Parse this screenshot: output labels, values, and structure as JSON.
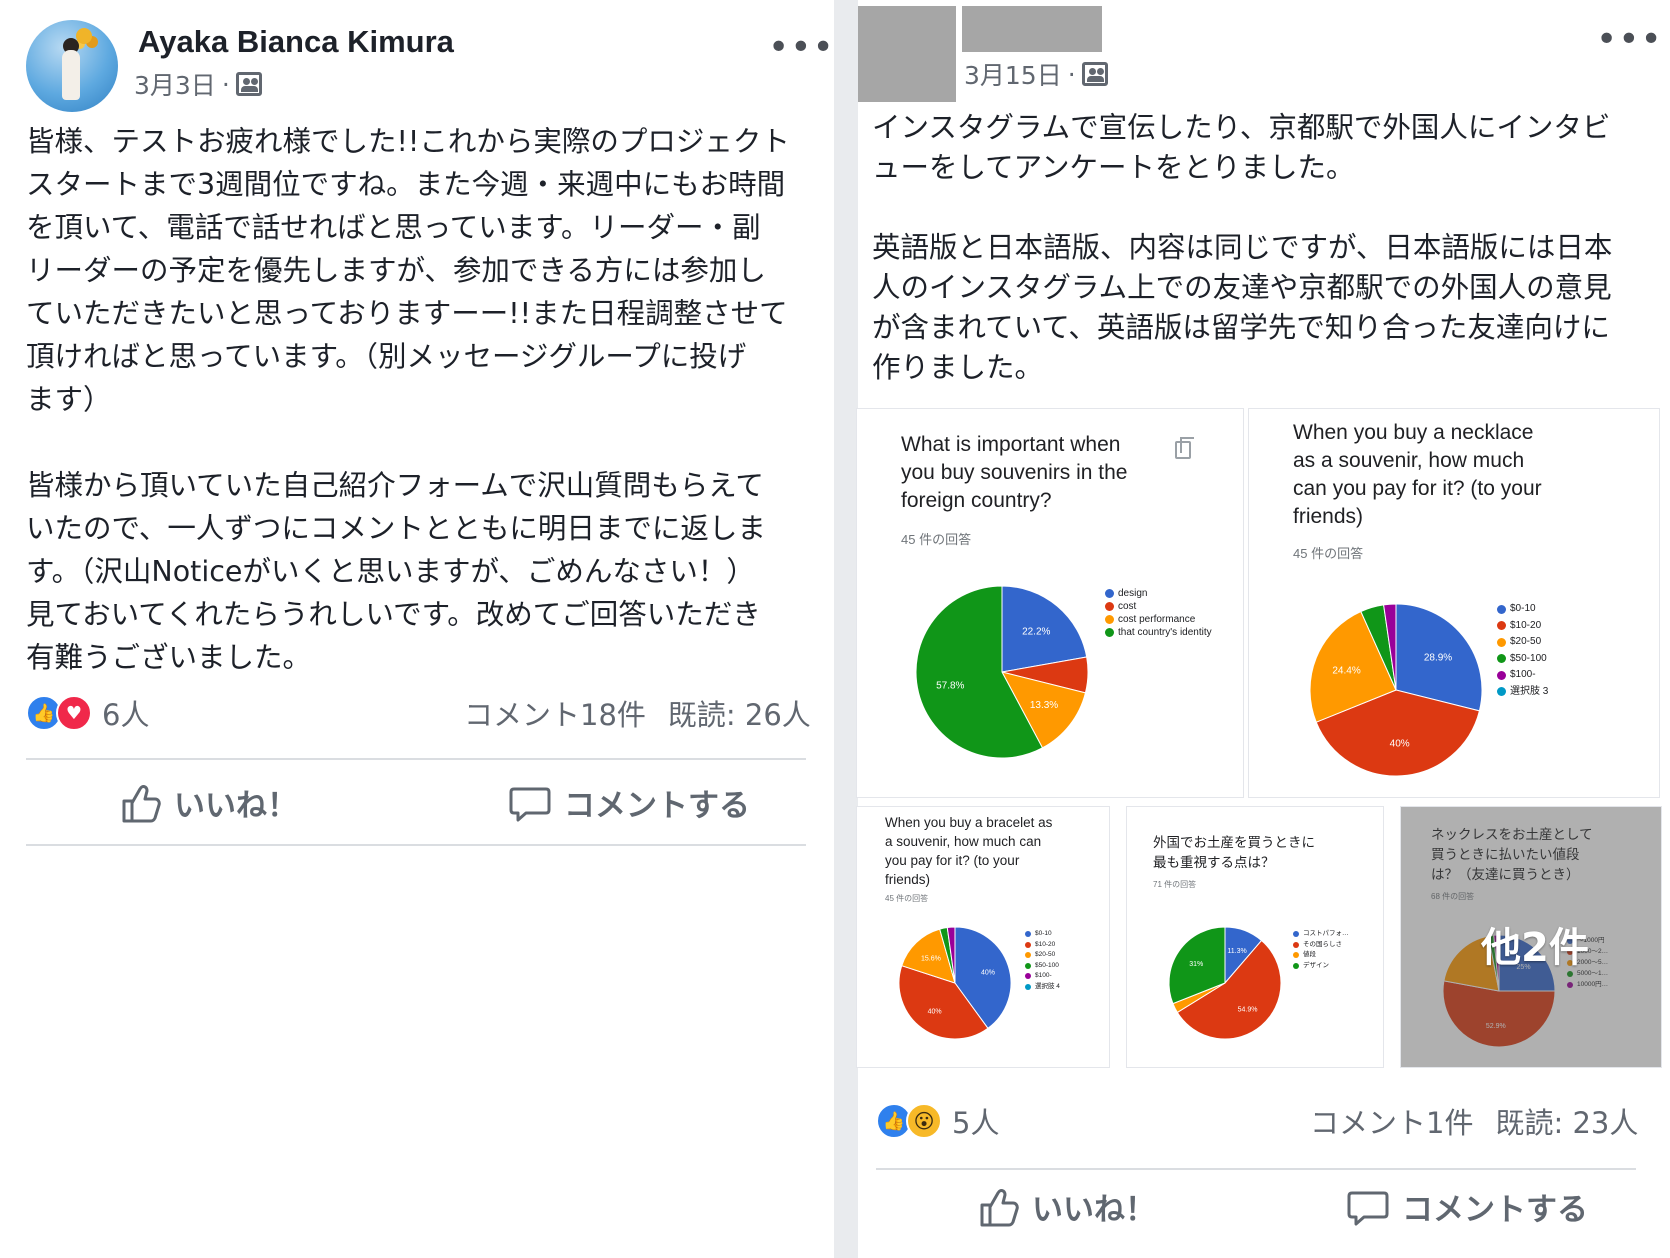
{
  "colors": {
    "blue": "#3366cc",
    "red": "#dc3912",
    "orange": "#ff9900",
    "green": "#109618",
    "purple": "#990099",
    "teal": "#0099c6"
  },
  "post1": {
    "author": "Ayaka Bianca Kimura",
    "date": "3月3日",
    "audience_icon": "group-audience-icon",
    "more": "•••",
    "body": "皆様、テストお疲れ様でした!!これから実際のプロジェクト\nスタートまで3週間位ですね。また今週・来週中にもお時間\nを頂いて、電話で話せればと思っています。リーダー・副\nリーダーの予定を優先しますが、参加できる方には参加し\nていただきたいと思っておりますーー!!また日程調整させて\n頂ければと思っています。（別メッセージグループに投げ\nます）\n\n皆様から頂いていた自己紹介フォームで沢山質問もらえて\nいたので、一人ずつにコメントとともに明日までに返しま\nす。（沢山Noticeがいくと思いますが、ごめんなさい！）\n見ておいてくれたらうれしいです。改めてご回答いただき\n有難うございました。",
    "reaction_count": "6人",
    "comments": "コメント18件",
    "seen": "既読: 26人",
    "like_label": "いいね！",
    "comment_label": "コメントする"
  },
  "post2": {
    "date": "3月15日",
    "more": "•••",
    "body": "インスタグラムで宣伝したり、京都駅で外国人にインタビ\nューをしてアンケートをとりました。\n\n英語版と日本語版、内容は同じですが、日本語版には日本\n人のインスタグラム上での友達や京都駅での外国人の意見\nが含まれていて、英語版は留学先で知り合った友達向けに\n作りました。",
    "reaction_count": "5人",
    "comments": "コメント1件",
    "seen": "既読: 23人",
    "like_label": "いいね！",
    "comment_label": "コメントする",
    "more_photos": "他2件"
  },
  "charts_text": {
    "c1": {
      "title": "What is important when\nyou buy souvenirs in the\nforeign country?",
      "responses": "45 件の回答"
    },
    "c2": {
      "title": "When you buy a necklace\nas a souvenir, how much\ncan you pay for it? (to your\nfriends)",
      "responses": "45 件の回答"
    },
    "c3": {
      "title": "When you buy a bracelet as\na souvenir, how much can\nyou pay for it? (to your\nfriends)",
      "responses": "45 件の回答"
    },
    "c4": {
      "title": "外国でお土産を買うときに\n最も重視する点は？",
      "responses": "71 件の回答"
    },
    "c5": {
      "title": "ネックレスをお土産として\n買うときに払いたい値段\nは？（友達に買うとき）",
      "responses": "68 件の回答"
    }
  },
  "chart_data": [
    {
      "type": "pie",
      "title": "What is important when you buy souvenirs in the foreign country?",
      "categories": [
        "design",
        "cost",
        "cost performance",
        "that country's identity"
      ],
      "values": [
        22.2,
        6.7,
        13.3,
        57.8
      ],
      "labels": [
        "22.2%",
        "",
        "13.3%",
        "57.8%"
      ],
      "colors": [
        "#3366cc",
        "#dc3912",
        "#ff9900",
        "#109618"
      ],
      "legend": "right"
    },
    {
      "type": "pie",
      "title": "When you buy a necklace as a souvenir, how much can you pay for it? (to your friends)",
      "categories": [
        "$0-10",
        "$10-20",
        "$20-50",
        "$50-100",
        "$100-",
        "選択肢 3"
      ],
      "values": [
        28.9,
        40,
        24.4,
        4.4,
        2.3,
        0
      ],
      "labels": [
        "28.9%",
        "40%",
        "24.4%",
        "",
        "",
        ""
      ],
      "colors": [
        "#3366cc",
        "#dc3912",
        "#ff9900",
        "#109618",
        "#990099",
        "#0099c6"
      ],
      "legend": "right"
    },
    {
      "type": "pie",
      "title": "When you buy a bracelet as a souvenir, how much can you pay for it? (to your friends)",
      "categories": [
        "$0-10",
        "$10-20",
        "$20-50",
        "$50-100",
        "$100-",
        "選択肢 4"
      ],
      "values": [
        40,
        40,
        15.6,
        2.2,
        2.2,
        0
      ],
      "labels": [
        "40%",
        "40%",
        "15.6%",
        "",
        "",
        ""
      ],
      "colors": [
        "#3366cc",
        "#dc3912",
        "#ff9900",
        "#109618",
        "#990099",
        "#0099c6"
      ],
      "legend": "right"
    },
    {
      "type": "pie",
      "title": "外国でお土産を買うときに最も重視する点は？",
      "categories": [
        "コストパフォ…",
        "その国らしさ",
        "値段",
        "デザイン"
      ],
      "values": [
        11.3,
        54.9,
        2.8,
        31
      ],
      "labels": [
        "11.3%",
        "54.9%",
        "",
        "31%"
      ],
      "colors": [
        "#3366cc",
        "#dc3912",
        "#ff9900",
        "#109618"
      ],
      "legend": "right"
    },
    {
      "type": "pie",
      "title": "ネックレスをお土産として買うときに払いたい値段は？（友達に買うとき）",
      "categories": [
        "〜1000円",
        "1000〜2…",
        "2000〜5…",
        "5000〜1…",
        "10000円…"
      ],
      "values": [
        25,
        52.9,
        19.1,
        1.5,
        1.5
      ],
      "labels": [
        "25%",
        "52.9%",
        "",
        "",
        ""
      ],
      "colors": [
        "#3366cc",
        "#dc3912",
        "#ff9900",
        "#109618",
        "#990099"
      ],
      "legend": "right"
    }
  ]
}
